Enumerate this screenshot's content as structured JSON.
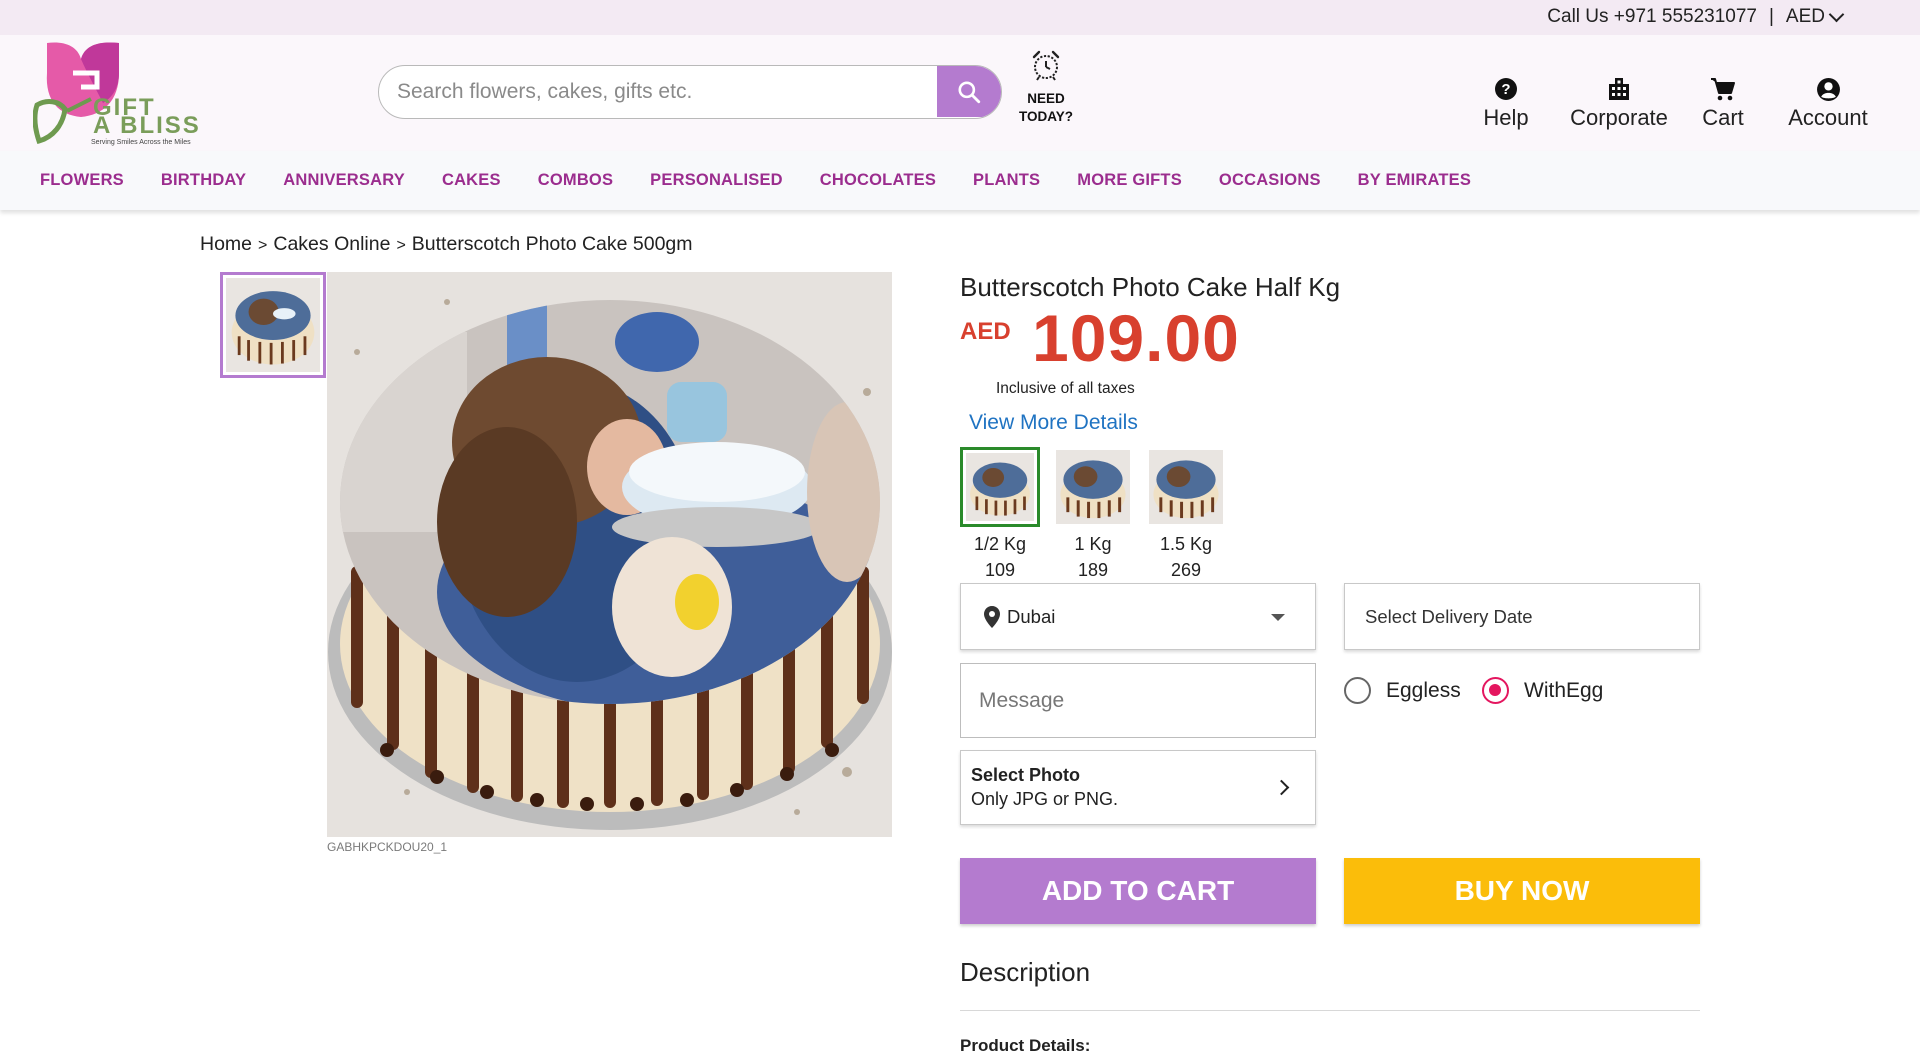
{
  "topbar": {
    "call_text": "Call Us +971 555231077",
    "separator": "|",
    "currency": "AED"
  },
  "header": {
    "logo": {
      "line1": "GIFT",
      "line2": "A BLISS",
      "tagline": "Serving Smiles Across the Miles"
    },
    "search": {
      "placeholder": "Search flowers, cakes, gifts etc.",
      "icon": "search-icon"
    },
    "need_today": {
      "line1": "NEED",
      "line2": "TODAY?",
      "icon": "alarm-clock-icon"
    },
    "nav": [
      {
        "label": "Help",
        "icon": "help-icon"
      },
      {
        "label": "Corporate",
        "icon": "building-icon"
      },
      {
        "label": "Cart",
        "icon": "cart-icon"
      },
      {
        "label": "Account",
        "icon": "account-icon"
      }
    ]
  },
  "categories": [
    "FLOWERS",
    "BIRTHDAY",
    "ANNIVERSARY",
    "CAKES",
    "COMBOS",
    "PERSONALISED",
    "CHOCOLATES",
    "PLANTS",
    "MORE GIFTS",
    "OCCASIONS",
    "BY EMIRATES"
  ],
  "breadcrumb": {
    "items": [
      "Home",
      "Cakes Online",
      "Butterscotch Photo Cake 500gm"
    ],
    "separator": ">"
  },
  "gallery": {
    "sku": "GABHKPCKDOU20_1"
  },
  "product": {
    "title": "Butterscotch Photo Cake Half Kg",
    "currency": "AED",
    "price": "109.00",
    "tax_note": "Inclusive of all taxes",
    "view_more": "View More Details",
    "variants": [
      {
        "weight": "1/2 Kg",
        "price": "109",
        "selected": true
      },
      {
        "weight": "1 Kg",
        "price": "189",
        "selected": false
      },
      {
        "weight": "1.5 Kg",
        "price": "269",
        "selected": false
      }
    ],
    "city": "Dubai",
    "delivery_date_placeholder": "Select Delivery Date",
    "message_placeholder": "Message",
    "photo": {
      "title": "Select Photo",
      "hint": "Only JPG or PNG."
    },
    "egg_options": [
      {
        "label": "Eggless",
        "selected": false
      },
      {
        "label": "WithEgg",
        "selected": true
      }
    ],
    "add_to_cart": "ADD TO CART",
    "buy_now": "BUY NOW"
  },
  "description": {
    "heading": "Description",
    "details_heading": "Product Details:"
  },
  "colors": {
    "brand_purple": "#b47bcf",
    "category_text": "#9b2d8e",
    "price_red": "#d8402e",
    "buy_yellow": "#fbbd0a",
    "link_blue": "#1f73c2",
    "selected_green": "#2a8a2a",
    "radio_pink": "#e4165f"
  }
}
